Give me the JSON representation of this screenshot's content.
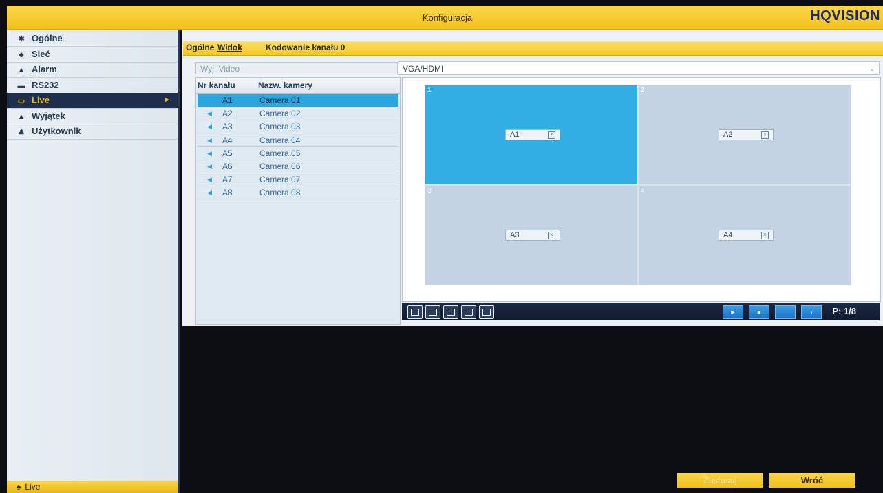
{
  "window": {
    "title": "Konfiguracja",
    "logo": "HQVISION",
    "logo_sub": ""
  },
  "sidebar": {
    "items": [
      {
        "label": "Ogólne",
        "icon": "gear-icon",
        "glyph": "✱",
        "active": false
      },
      {
        "label": "Sieć",
        "icon": "network-icon",
        "glyph": "♣",
        "active": false
      },
      {
        "label": "Alarm",
        "icon": "alarm-icon",
        "glyph": "▲",
        "active": false
      },
      {
        "label": "RS232",
        "icon": "rs232-icon",
        "glyph": "▬",
        "active": false
      },
      {
        "label": "Live",
        "icon": "live-icon",
        "glyph": "▭",
        "active": true
      },
      {
        "label": "Wyjątek",
        "icon": "warning-icon",
        "glyph": "▲",
        "active": false
      },
      {
        "label": "Użytkownik",
        "icon": "users-icon",
        "glyph": "♟",
        "active": false
      }
    ],
    "active_arrow": "►",
    "bottom_button": {
      "label": "Live",
      "icon": "home-icon",
      "glyph": "♠"
    }
  },
  "tabs": [
    {
      "label": "Ogólne",
      "active": false
    },
    {
      "label": "Widok",
      "active": true
    },
    {
      "label": "Kodowanie kanału 0",
      "active": false
    }
  ],
  "video_output": {
    "label": "Wyj. Video",
    "value": "VGA/HDMI",
    "chevron": "⌄"
  },
  "camera_table": {
    "headers": [
      "Nr kanału",
      "Nazw. kamery"
    ],
    "rows": [
      {
        "num": "A1",
        "name": "Camera 01",
        "selected": true
      },
      {
        "num": "A2",
        "name": "Camera 02",
        "selected": false
      },
      {
        "num": "A3",
        "name": "Camera 03",
        "selected": false
      },
      {
        "num": "A4",
        "name": "Camera 04",
        "selected": false
      },
      {
        "num": "A5",
        "name": "Camera 05",
        "selected": false
      },
      {
        "num": "A6",
        "name": "Camera 06",
        "selected": false
      },
      {
        "num": "A7",
        "name": "Camera 07",
        "selected": false
      },
      {
        "num": "A8",
        "name": "Camera 08",
        "selected": false
      }
    ]
  },
  "preview": {
    "cells": [
      {
        "index": "1",
        "label": "A1",
        "selected": true
      },
      {
        "index": "2",
        "label": "A2",
        "selected": false
      },
      {
        "index": "3",
        "label": "A3",
        "selected": false
      },
      {
        "index": "4",
        "label": "A4",
        "selected": false
      }
    ],
    "close_glyph": "×"
  },
  "controls": {
    "layouts": [
      "layout-1x1-icon",
      "layout-2x2-icon",
      "layout-1plus5-icon",
      "layout-1plus7-icon",
      "layout-3x3-icon"
    ],
    "nav": [
      {
        "icon": "play-icon",
        "glyph": "►"
      },
      {
        "icon": "stop-icon",
        "glyph": "■"
      },
      {
        "icon": "prev-page-icon",
        "glyph": ""
      },
      {
        "icon": "next-page-icon",
        "glyph": "›"
      }
    ],
    "page": "P: 1/8"
  },
  "buttons": {
    "apply": "Zastosuj",
    "back": "Wróć"
  },
  "colors": {
    "accent": "#f2c21c",
    "sidebar_active": "#1e2f4c",
    "selection": "#2aa5de"
  }
}
